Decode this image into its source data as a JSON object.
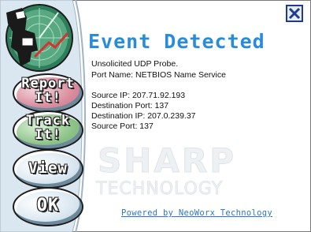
{
  "dialog": {
    "title": "Event Detected",
    "close_glyph": "X",
    "close_icon": "close-x-icon",
    "logo_icon": "hacker-radar-logo"
  },
  "message": {
    "line1": "Unsolicited UDP Probe.",
    "line2": "Port Name: NETBIOS Name Service",
    "source_ip": "Source IP: 207.71.92.193",
    "dest_port": "Destination Port: 137",
    "dest_ip": "Destination IP: 207.0.239.37",
    "source_port": "Source Port: 137"
  },
  "buttons": {
    "report_line1": "Report",
    "report_line2": "It!",
    "track_line1": "Track",
    "track_line2": "It!",
    "view": "View",
    "ok": "OK"
  },
  "watermark": {
    "word1": "SHARP",
    "word2": "TECHNOLOGY"
  },
  "footer": {
    "credit": "Powered by NeoWorx Technology"
  },
  "colors": {
    "title": "#2a8cd8",
    "sidebar": "#dbe7f0",
    "report": "#d98d9e",
    "track": "#8fc489",
    "link": "#2a78c8"
  }
}
